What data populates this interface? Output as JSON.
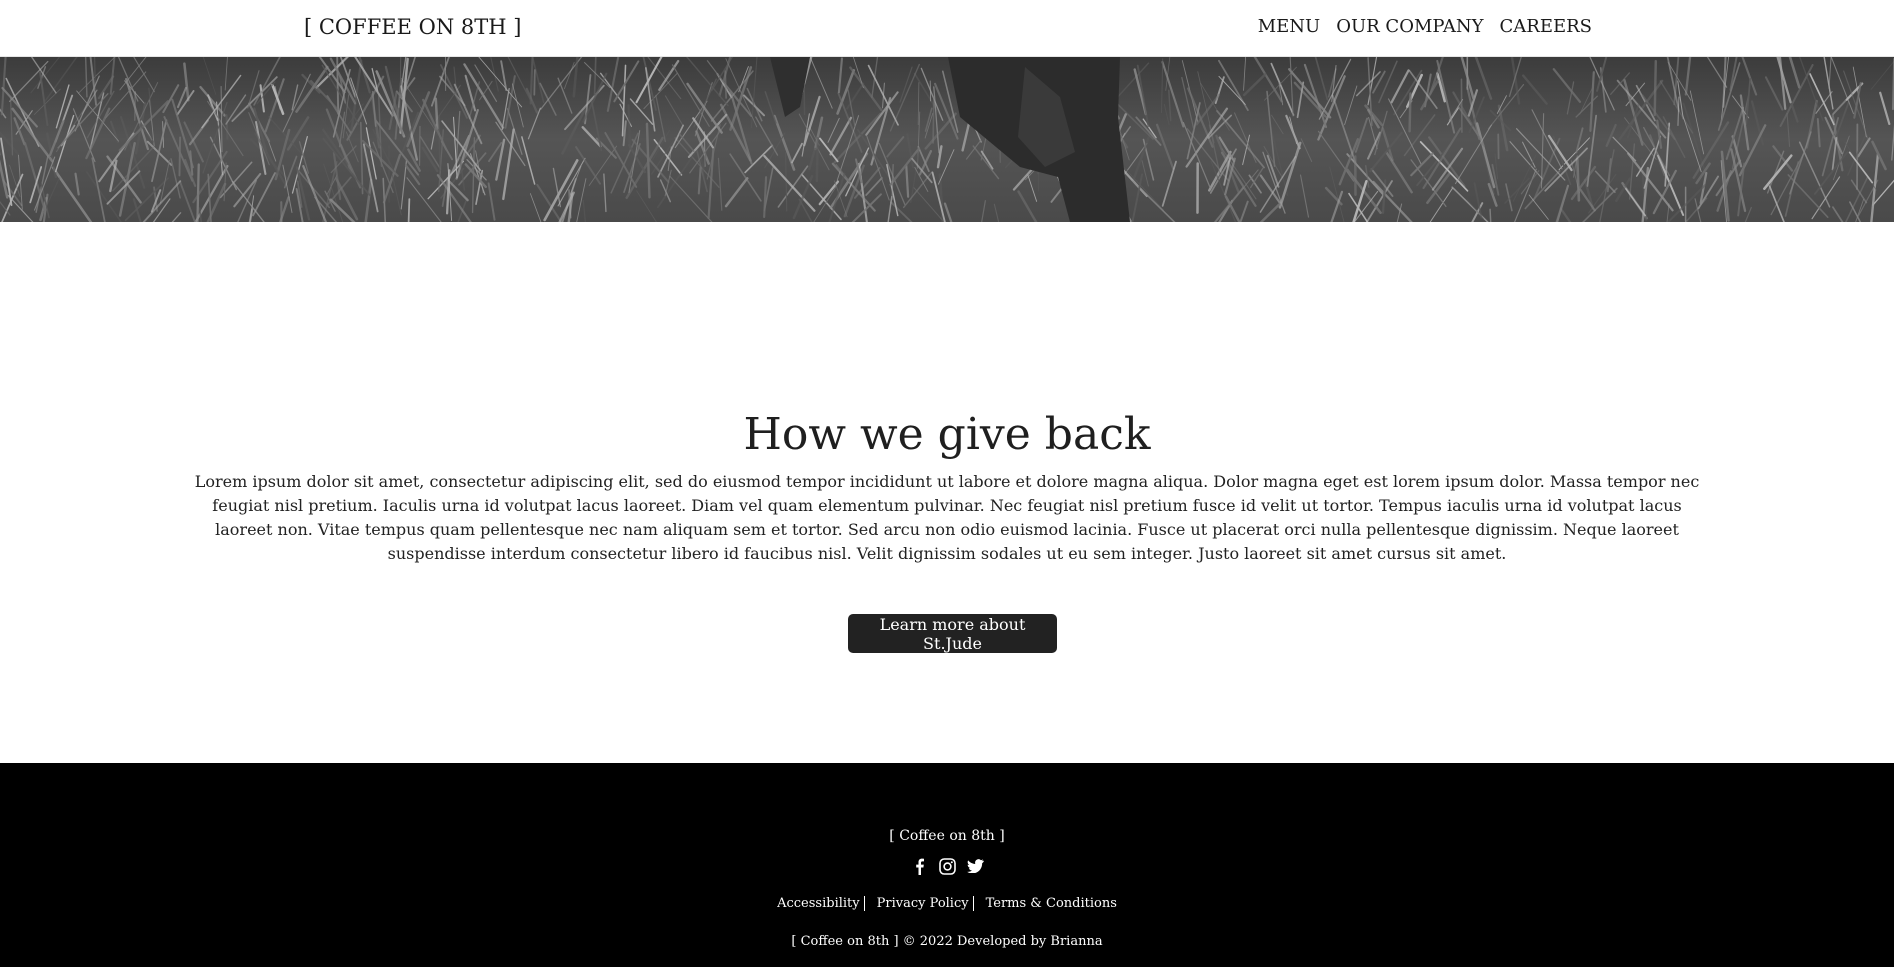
{
  "navbar": {
    "brand": "[ COFFEE ON 8TH ]",
    "links": [
      "MENU",
      "OUR COMPANY",
      "CAREERS"
    ]
  },
  "hero": {
    "image": "grayscale-grass-field-with-legs"
  },
  "giveback": {
    "title": "How we give back",
    "body": "Lorem ipsum dolor sit amet, consectetur adipiscing elit, sed do eiusmod tempor incididunt ut labore et dolore magna aliqua. Dolor magna eget est lorem ipsum dolor. Massa tempor nec feugiat nisl pretium. Iaculis urna id volutpat lacus laoreet. Diam vel quam elementum pulvinar. Nec feugiat nisl pretium fusce id velit ut tortor. Tempus iaculis urna id volutpat lacus laoreet non. Vitae tempus quam pellentesque nec nam aliquam sem et tortor. Sed arcu non odio euismod lacinia. Fusce ut placerat orci nulla pellentesque dignissim. Neque laoreet suspendisse interdum consectetur libero id faucibus nisl. Velit dignissim sodales ut eu sem integer. Justo laoreet sit amet cursus sit amet.",
    "button_label": "Learn more about St.Jude"
  },
  "footer": {
    "brand": "[ Coffee on 8th ]",
    "socials": [
      "facebook-icon",
      "instagram-icon",
      "twitter-icon"
    ],
    "links": [
      "Accessibility",
      "Privacy Policy",
      "Terms & Conditions"
    ],
    "copyright": "[ Coffee on 8th ] © 2022 Developed by Brianna"
  },
  "colors": {
    "button_bg": "#222222",
    "footer_bg": "#000000",
    "text": "#222222"
  }
}
